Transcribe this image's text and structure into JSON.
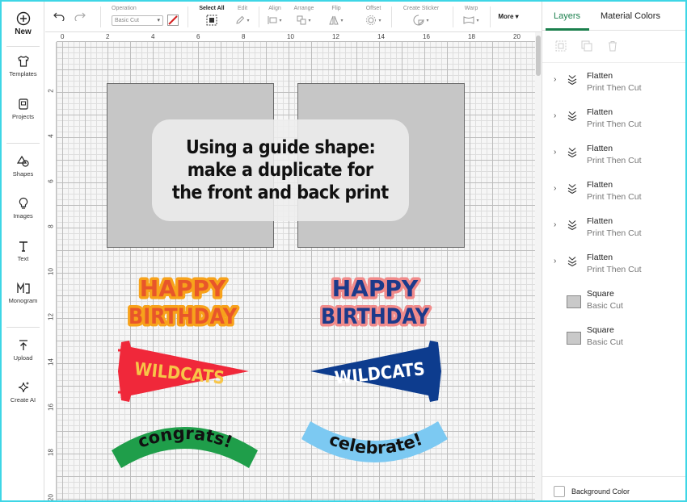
{
  "sidebar": {
    "new_label": "New",
    "items": [
      {
        "label": "Templates",
        "icon": "shirt-icon"
      },
      {
        "label": "Projects",
        "icon": "projects-icon"
      },
      {
        "label": "Shapes",
        "icon": "shapes-icon"
      },
      {
        "label": "Images",
        "icon": "bulb-icon"
      },
      {
        "label": "Text",
        "icon": "text-icon"
      },
      {
        "label": "Monogram",
        "icon": "monogram-icon"
      },
      {
        "label": "Upload",
        "icon": "upload-icon"
      },
      {
        "label": "Create AI",
        "icon": "sparkle-icon"
      }
    ]
  },
  "toolbar": {
    "operation_label": "Operation",
    "operation_value": "Basic Cut",
    "select_all_label": "Select All",
    "edit_label": "Edit",
    "align_label": "Align",
    "arrange_label": "Arrange",
    "flip_label": "Flip",
    "offset_label": "Offset",
    "create_sticker_label": "Create Sticker",
    "warp_label": "Warp",
    "more_label": "More"
  },
  "rulers": {
    "top": [
      "0",
      "2",
      "4",
      "6",
      "8",
      "10",
      "12",
      "14",
      "16",
      "18",
      "20"
    ],
    "left": [
      "2",
      "4",
      "6",
      "8",
      "10",
      "12",
      "14",
      "16",
      "18",
      "20"
    ]
  },
  "canvas": {
    "callout_lines": [
      "Using a guide shape:",
      "make a duplicate for",
      "the front and back print"
    ],
    "artwork": {
      "happy_left": [
        "HAPPY",
        "BIRTHDAY"
      ],
      "happy_right": [
        "HAPPY",
        "BIRTHDAY"
      ],
      "wildcats_left": "WILDCATS",
      "wildcats_right": "WILDCATS",
      "congrats": "congrats!",
      "celebrate": "celebrate!"
    }
  },
  "panel": {
    "tabs": [
      "Layers",
      "Material Colors"
    ],
    "layers": [
      {
        "name": "Flatten",
        "sub": "Print Then Cut",
        "type": "flatten"
      },
      {
        "name": "Flatten",
        "sub": "Print Then Cut",
        "type": "flatten"
      },
      {
        "name": "Flatten",
        "sub": "Print Then Cut",
        "type": "flatten"
      },
      {
        "name": "Flatten",
        "sub": "Print Then Cut",
        "type": "flatten"
      },
      {
        "name": "Flatten",
        "sub": "Print Then Cut",
        "type": "flatten"
      },
      {
        "name": "Flatten",
        "sub": "Print Then Cut",
        "type": "flatten"
      },
      {
        "name": "Square",
        "sub": "Basic Cut",
        "type": "shape"
      },
      {
        "name": "Square",
        "sub": "Basic Cut",
        "type": "shape"
      }
    ],
    "background_color_label": "Background Color"
  },
  "colors": {
    "frame": "#3ed6e6",
    "accent": "#1a7f4c",
    "birthday_orange": "#e8562a",
    "birthday_yellow": "#f7a21b",
    "birthday_navy": "#1c3a8a",
    "birthday_pink": "#f08a8a",
    "wildcats_red": "#f0283a",
    "wildcats_navy": "#0d3c8e",
    "congrats_green": "#1f9e4a",
    "celebrate_blue": "#7cc9f2"
  }
}
